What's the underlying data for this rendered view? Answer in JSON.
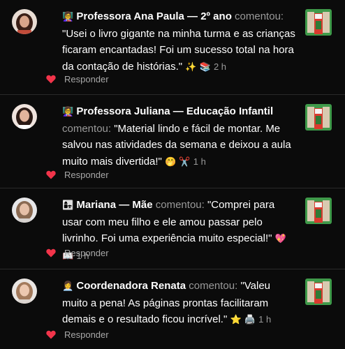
{
  "colors": {
    "background": "#000000",
    "author": "#ffffff",
    "muted": "#9a9a9a",
    "heart": "#f2344a"
  },
  "comments": [
    {
      "author_emoji": "👩‍🏫",
      "author": "Professora Ana Paula — 2º ano",
      "verb": "comentou:",
      "text": "\"Usei o livro gigante na minha turma e as crianças ficaram encantadas! Foi um sucesso total na hora da contação de histórias.\"",
      "emojis": "✨ 📚",
      "time": "2 h",
      "reply_label": "Responder",
      "like_icon": "heart-icon"
    },
    {
      "author_emoji": "👩‍🏫",
      "author": "Professora Juliana — Educação Infantil",
      "verb": "comentou:",
      "text": "\"Material lindo e fácil de montar. Me salvou nas atividades da semana e deixou a aula muito mais divertida!\"",
      "emojis": "🤭 ✂️",
      "time": "1 h",
      "reply_label": "Responder",
      "like_icon": "heart-icon"
    },
    {
      "author_emoji": "👩‍👧",
      "author": "Mariana — Mãe",
      "verb": "comentou:",
      "text": "\"Comprei para usar com meu filho e ele amou passar pelo livrinho. Foi uma experiência muito especial!\"",
      "emojis": "💖 📖",
      "time": "1 h",
      "reply_label": "Responder",
      "like_icon": "heart-icon"
    },
    {
      "author_emoji": "👩‍💼",
      "author": "Coordenadora Renata",
      "verb": "comentou:",
      "text": "\"Valeu muito a pena! As páginas prontas facilitaram demais e o resultado ficou incrível.\"",
      "emojis": "⭐ 🖨️",
      "time": "1 h",
      "reply_label": "Responder",
      "like_icon": "heart-icon"
    }
  ]
}
